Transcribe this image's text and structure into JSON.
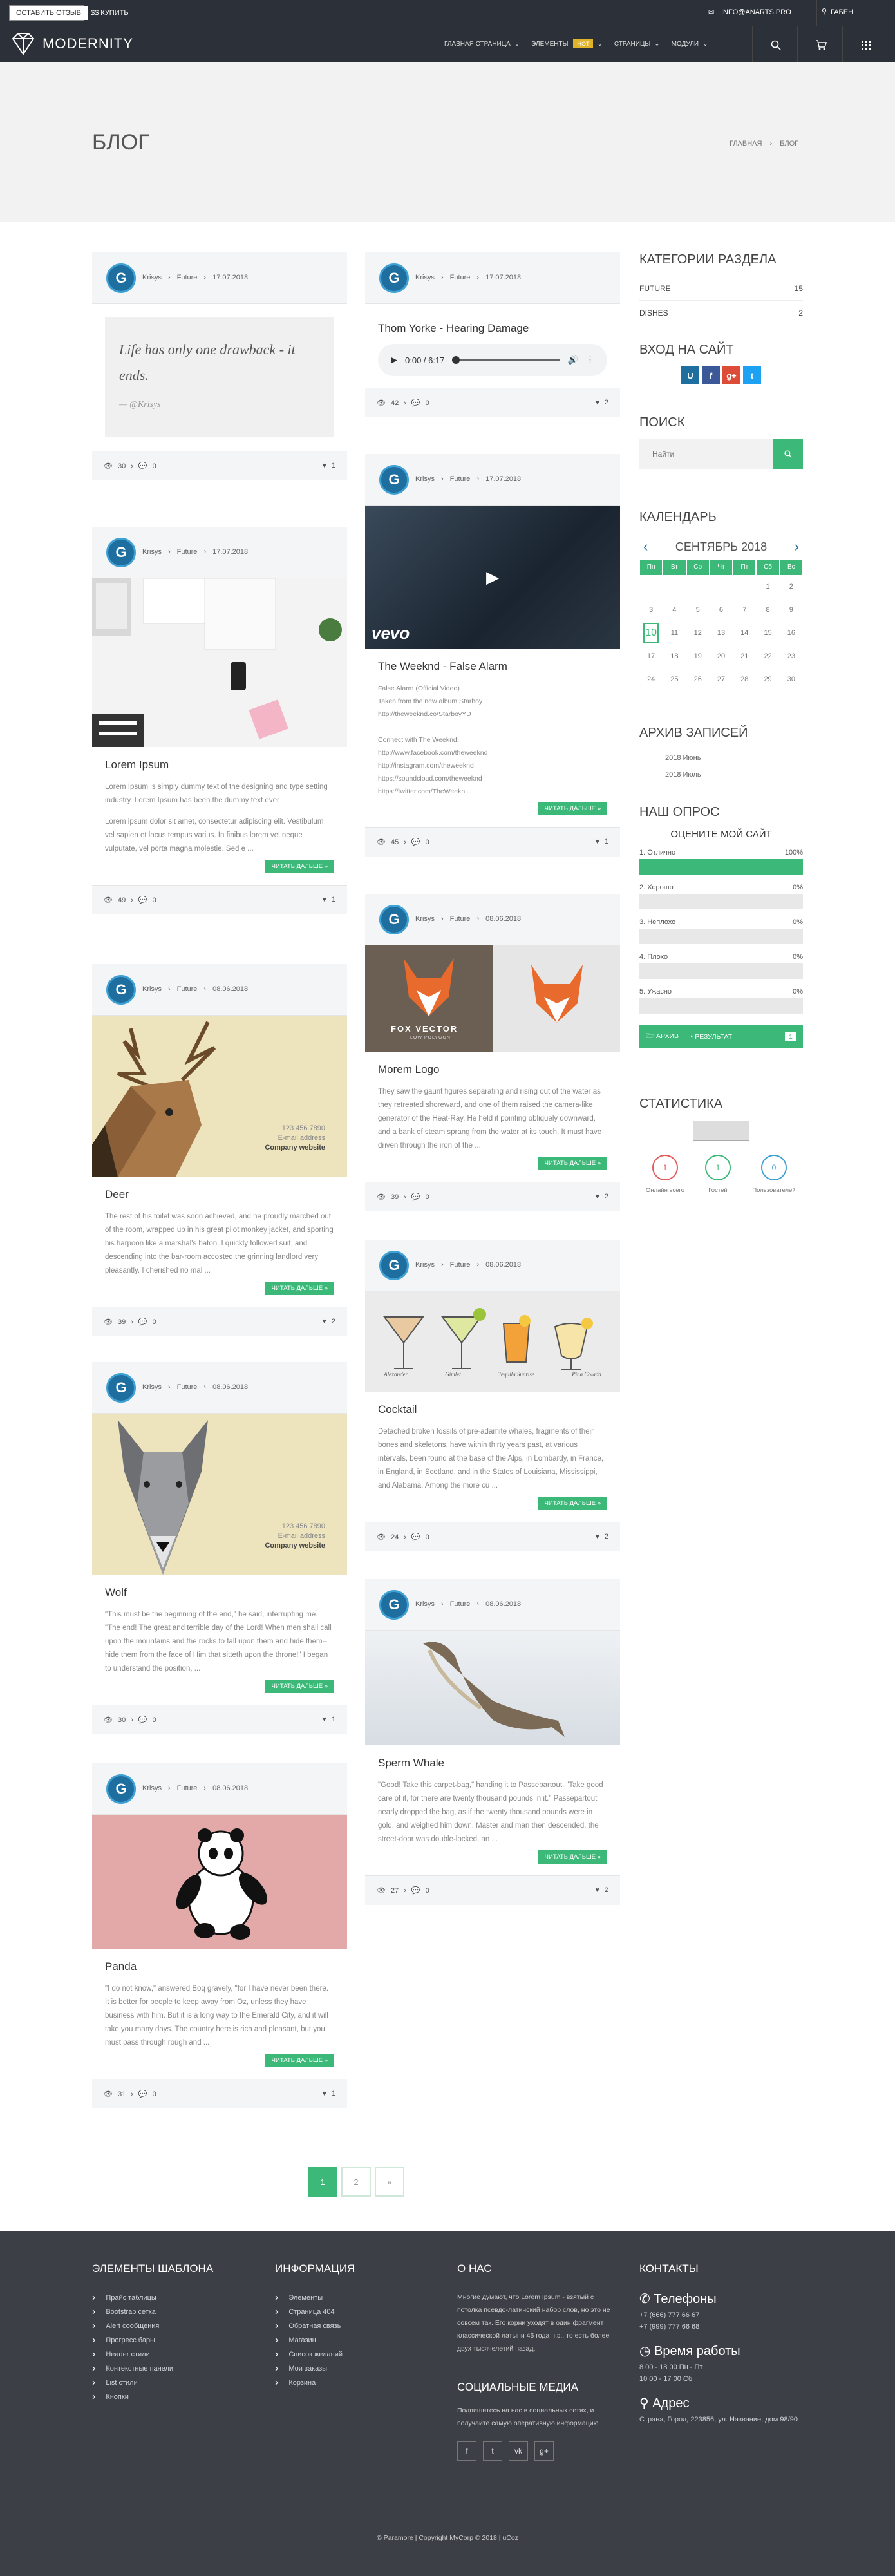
{
  "topbar": {
    "review_btn": "ОСТАВИТЬ ОТЗЫВ",
    "buy_btn": "$$ КУПИТЬ",
    "email": "INFO@ANARTS.PRO",
    "user": "ГАБЕН"
  },
  "nav": {
    "brand": "MODERNITY",
    "menu": [
      "ГЛАВНАЯ СТРАНИЦА",
      "ЭЛЕМЕНТЫ",
      "СТРАНИЦЫ",
      "МОДУЛИ"
    ],
    "hot": "HOT"
  },
  "hero": {
    "title": "БЛОГ",
    "crumb_home": "ГЛАВНАЯ",
    "crumb_current": "БЛОГ"
  },
  "common": {
    "author": "Krisys",
    "category": "Future",
    "read_more": "ЧИТАТЬ ДАЛЬШЕ »"
  },
  "posts": {
    "p1": {
      "date": "17.07.2018",
      "quote": "Life has only one drawback - it ends.",
      "quote_author": "— @Krisys",
      "views": "30",
      "comments": "0",
      "likes": "1"
    },
    "p2": {
      "date": "17.07.2018",
      "title": "Lorem Ipsum",
      "text1": "Lorem Ipsum is simply dummy text of the designing and type setting industry. Lorem Ipsum has been the dummy text ever",
      "text2": "Lorem ipsum dolor sit amet, consectetur adipiscing elit. Vestibulum vel sapien et lacus tempus varius. In finibus lorem vel neque vulputate, vel porta magna molestie. Sed e ...",
      "views": "49",
      "comments": "0",
      "likes": "1"
    },
    "p3": {
      "date": "08.06.2018",
      "title": "Deer",
      "img_phone": "123 456 7890",
      "img_email": "E-mail address",
      "img_site": "Company website",
      "text": "The rest of his toilet was soon achieved, and he proudly marched out of the room, wrapped up in his great pilot monkey jacket, and sporting his harpoon like a marshal's baton. I quickly followed suit, and descending into the bar-room accosted the grinning landlord very pleasantly. I cherished no mal ...",
      "views": "39",
      "comments": "0",
      "likes": "2"
    },
    "p4": {
      "date": "08.06.2018",
      "title": "Wolf",
      "img_phone": "123 456 7890",
      "img_email": "E-mail address",
      "img_site": "Company website",
      "text": "\"This must be the beginning of the end,\" he said, interrupting me. \"The end! The great and terrible day of the Lord! When men shall call upon the mountains and the rocks to fall upon them and hide them--hide them from the face of Him that sitteth upon the throne!\" I began to understand the position, ...",
      "views": "30",
      "comments": "0",
      "likes": "1"
    },
    "p5": {
      "date": "08.06.2018",
      "title": "Panda",
      "text": "\"I do not know,\" answered Boq gravely, \"for I have never been there. It is better for people to keep away from Oz, unless they have business with him. But it is a long way to the Emerald City, and it will take you many days. The country here is rich and pleasant, but you must pass through rough and ...",
      "views": "31",
      "comments": "0",
      "likes": "1"
    },
    "p6": {
      "date": "17.07.2018",
      "title": "Thom Yorke - Hearing Damage",
      "audio_time": "0:00 / 6:17",
      "views": "42",
      "comments": "0",
      "likes": "2"
    },
    "p7": {
      "date": "17.07.2018",
      "title": "The Weeknd - False Alarm",
      "video_logo": "vevo",
      "text_lines": [
        "False Alarm (Official Video)",
        "Taken from the new album Starboy",
        "http://theweeknd.co/StarboyYD",
        "",
        "Connect with The Weeknd:",
        "http://www.facebook.com/theweeknd",
        "http://instagram.com/theweeknd",
        "https://soundcloud.com/theweeknd",
        "https://twitter.com/TheWeekn..."
      ],
      "views": "45",
      "comments": "0",
      "likes": "1"
    },
    "p8": {
      "date": "08.06.2018",
      "title": "Morem Logo",
      "img_caption": "FOX VECTOR",
      "img_sub": "LOW POLYGON",
      "text": "They saw the gaunt figures separating and rising out of the water as they retreated shoreward, and one of them raised the camera-like generator of the Heat-Ray. He held it pointing obliquely downward, and a bank of steam sprang from the water at its touch. It must have driven through the iron of the ...",
      "views": "39",
      "comments": "0",
      "likes": "2"
    },
    "p9": {
      "date": "08.06.2018",
      "title": "Cocktail",
      "cocktails": [
        "Alexander",
        "Gimlet",
        "Tequila Sunrise",
        "Pina Colada"
      ],
      "text": "Detached broken fossils of pre-adamite whales, fragments of their bones and skeletons, have within thirty years past, at various intervals, been found at the base of the Alps, in Lombardy, in France, in England, in Scotland, and in the States of Louisiana, Mississippi, and Alabama. Among the more cu ...",
      "views": "24",
      "comments": "0",
      "likes": "2"
    },
    "p10": {
      "date": "08.06.2018",
      "title": "Sperm Whale",
      "text": "\"Good! Take this carpet-bag,\" handing it to Passepartout. \"Take good care of it, for there are twenty thousand pounds in it.\" Passepartout nearly dropped the bag, as if the twenty thousand pounds were in gold, and weighed him down. Master and man then descended, the street-door was double-locked, an ...",
      "views": "27",
      "comments": "0",
      "likes": "2"
    }
  },
  "sidebar": {
    "cat_title": "КАТЕГОРИИ РАЗДЕЛА",
    "cats": [
      {
        "name": "FUTURE",
        "count": "15"
      },
      {
        "name": "DISHES",
        "count": "2"
      }
    ],
    "login_title": "ВХОД НА САЙТ",
    "search_title": "ПОИСК",
    "search_placeholder": "Найти",
    "cal_title": "КАЛЕНДАРЬ",
    "cal_month": "СЕНТЯБРЬ 2018",
    "weekdays": [
      "Пн",
      "Вт",
      "Ср",
      "Чт",
      "Пт",
      "Сб",
      "Вс"
    ],
    "archive_title": "АРХИВ ЗАПИСЕЙ",
    "archive": [
      "2018 Июнь",
      "2018 Июль"
    ],
    "poll_title": "НАШ ОПРОС",
    "poll_q": "ОЦЕНИТЕ МОЙ САЙТ",
    "poll": [
      {
        "label": "1. Отлично",
        "pct": "100%",
        "value": 100
      },
      {
        "label": "2. Хорошо",
        "pct": "0%",
        "value": 0
      },
      {
        "label": "3. Неплохо",
        "pct": "0%",
        "value": 0
      },
      {
        "label": "4. Плохо",
        "pct": "0%",
        "value": 0
      },
      {
        "label": "5. Ужасно",
        "pct": "0%",
        "value": 0
      }
    ],
    "poll_archive": "АРХИВ",
    "poll_results": "РЕЗУЛЬТАТ",
    "poll_count": "1",
    "stat_title": "СТАТИСТИКА",
    "stats": [
      {
        "n": "1",
        "label": "Онлайн всего"
      },
      {
        "n": "1",
        "label": "Гостей"
      },
      {
        "n": "0",
        "label": "Пользователей"
      }
    ]
  },
  "pager": {
    "p1": "1",
    "p2": "2",
    "next": "»"
  },
  "footer": {
    "col1_title": "ЭЛЕМЕНТЫ ШАБЛОНА",
    "col1": [
      "Прайс таблицы",
      "Bootstrap сетка",
      "Alert сообщения",
      "Прогресс бары",
      "Header стили",
      "Контекстные панели",
      "List стили",
      "Кнопки"
    ],
    "col2_title": "ИНФОРМАЦИЯ",
    "col2": [
      "Элементы",
      "Страница 404",
      "Обратная связь",
      "Магазин",
      "Список желаний",
      "Мои заказы",
      "Корзина"
    ],
    "about_title": "О НАС",
    "about": "Многие думают, что Lorem Ipsum - взятый с потолка псевдо-латинский набор слов, но это не совсем так. Его корни уходят в один фрагмент классической латыни 45 года н.э., то есть более двух тысячелетий назад.",
    "social_title": "СОЦИАЛЬНЫЕ МЕДИА",
    "social_text": "Подпишитесь на нас в социальных сетях, и получайте самую оперативную информацию",
    "contacts_title": "КОНТАКТЫ",
    "phones_title": "Телефоны",
    "phone1": "+7 (666) 777 66 67",
    "phone2": "+7 (999) 777 66 68",
    "hours_title": "Время работы",
    "hours1": "8 00 - 18 00 Пн - Пт",
    "hours2": "10 00 - 17 00 Сб",
    "addr_title": "Адрес",
    "addr": "Страна, Город, 223856, ул. Название, дом 98/90",
    "copyright": "© Paramore | Copyright MyCorp © 2018 | uCoz"
  }
}
